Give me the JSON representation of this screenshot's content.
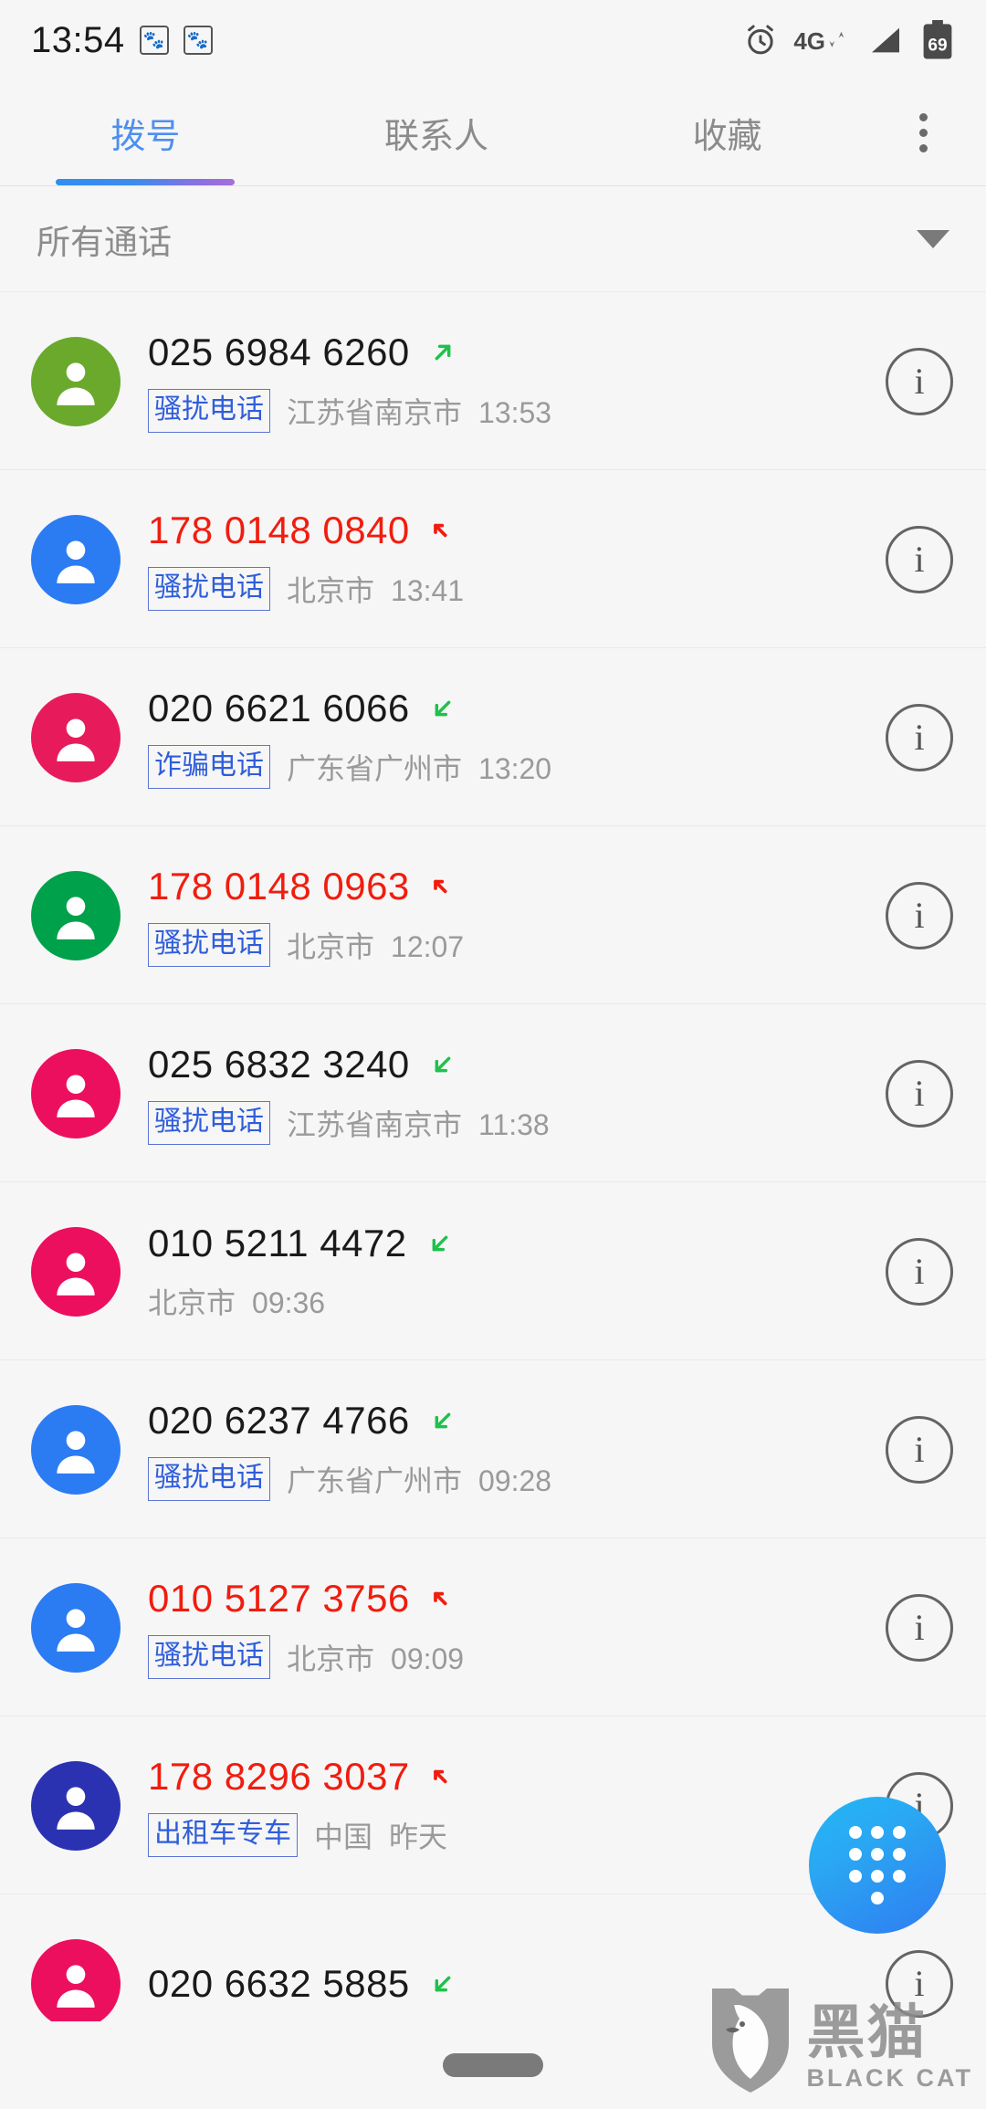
{
  "status_bar": {
    "clock": "13:54",
    "paw_badges": [
      "paw-icon",
      "paw-icon"
    ],
    "alarm_icon": "alarm-clock-icon",
    "network_label": "4G",
    "data_arrows": "down-up-arrows-icon",
    "signal_icon": "signal-bars-icon",
    "battery_level": "69"
  },
  "tabs": [
    {
      "label": "拨号",
      "active": true
    },
    {
      "label": "联系人",
      "active": false
    },
    {
      "label": "收藏",
      "active": false
    }
  ],
  "overflow_menu": "more-options-icon",
  "filter": {
    "label": "所有通话",
    "caret": "chevron-down-icon"
  },
  "calls": [
    {
      "number": "025 6984 6260",
      "number_color": "#1a1a1a",
      "call_type": "outgoing",
      "tag": "骚扰电话",
      "location": "江苏省南京市",
      "time": "13:53",
      "avatar_color": "#6aa92c"
    },
    {
      "number": "178 0148 0840",
      "number_color": "#f01d0f",
      "call_type": "missed",
      "tag": "骚扰电话",
      "location": "北京市",
      "time": "13:41",
      "avatar_color": "#2b7bf3"
    },
    {
      "number": "020 6621 6066",
      "number_color": "#1a1a1a",
      "call_type": "incoming",
      "tag": "诈骗电话",
      "location": "广东省广州市",
      "time": "13:20",
      "avatar_color": "#e71b5c"
    },
    {
      "number": "178 0148 0963",
      "number_color": "#f01d0f",
      "call_type": "missed",
      "tag": "骚扰电话",
      "location": "北京市",
      "time": "12:07",
      "avatar_color": "#00a14b"
    },
    {
      "number": "025 6832 3240",
      "number_color": "#1a1a1a",
      "call_type": "incoming",
      "tag": "骚扰电话",
      "location": "江苏省南京市",
      "time": "11:38",
      "avatar_color": "#ec0f5e"
    },
    {
      "number": "010 5211 4472",
      "number_color": "#1a1a1a",
      "call_type": "incoming",
      "tag": "",
      "location": "北京市",
      "time": "09:36",
      "avatar_color": "#ec0f5e"
    },
    {
      "number": "020 6237 4766",
      "number_color": "#1a1a1a",
      "call_type": "incoming",
      "tag": "骚扰电话",
      "location": "广东省广州市",
      "time": "09:28",
      "avatar_color": "#2b7bf3"
    },
    {
      "number": "010 5127 3756",
      "number_color": "#f01d0f",
      "call_type": "missed",
      "tag": "骚扰电话",
      "location": "北京市",
      "time": "09:09",
      "avatar_color": "#2b7bf3"
    },
    {
      "number": "178 8296 3037",
      "number_color": "#f01d0f",
      "call_type": "missed",
      "tag": "出租车专车",
      "location": "中国",
      "time": "昨天",
      "avatar_color": "#2b32b2"
    },
    {
      "number": "020 6632 5885",
      "number_color": "#1a1a1a",
      "call_type": "incoming",
      "tag": "",
      "location": "",
      "time": "",
      "avatar_color": "#ec0f5e"
    }
  ],
  "fab": {
    "icon": "dialpad-icon"
  },
  "watermark": {
    "cn": "黑猫",
    "en": "BLACK CAT"
  },
  "colors": {
    "accent_blue": "#4d8ff0",
    "tag_blue": "#2f5ddb",
    "missed_red": "#f01d0f",
    "incoming_green": "#1fc14b",
    "background": "#f6f6f6"
  }
}
